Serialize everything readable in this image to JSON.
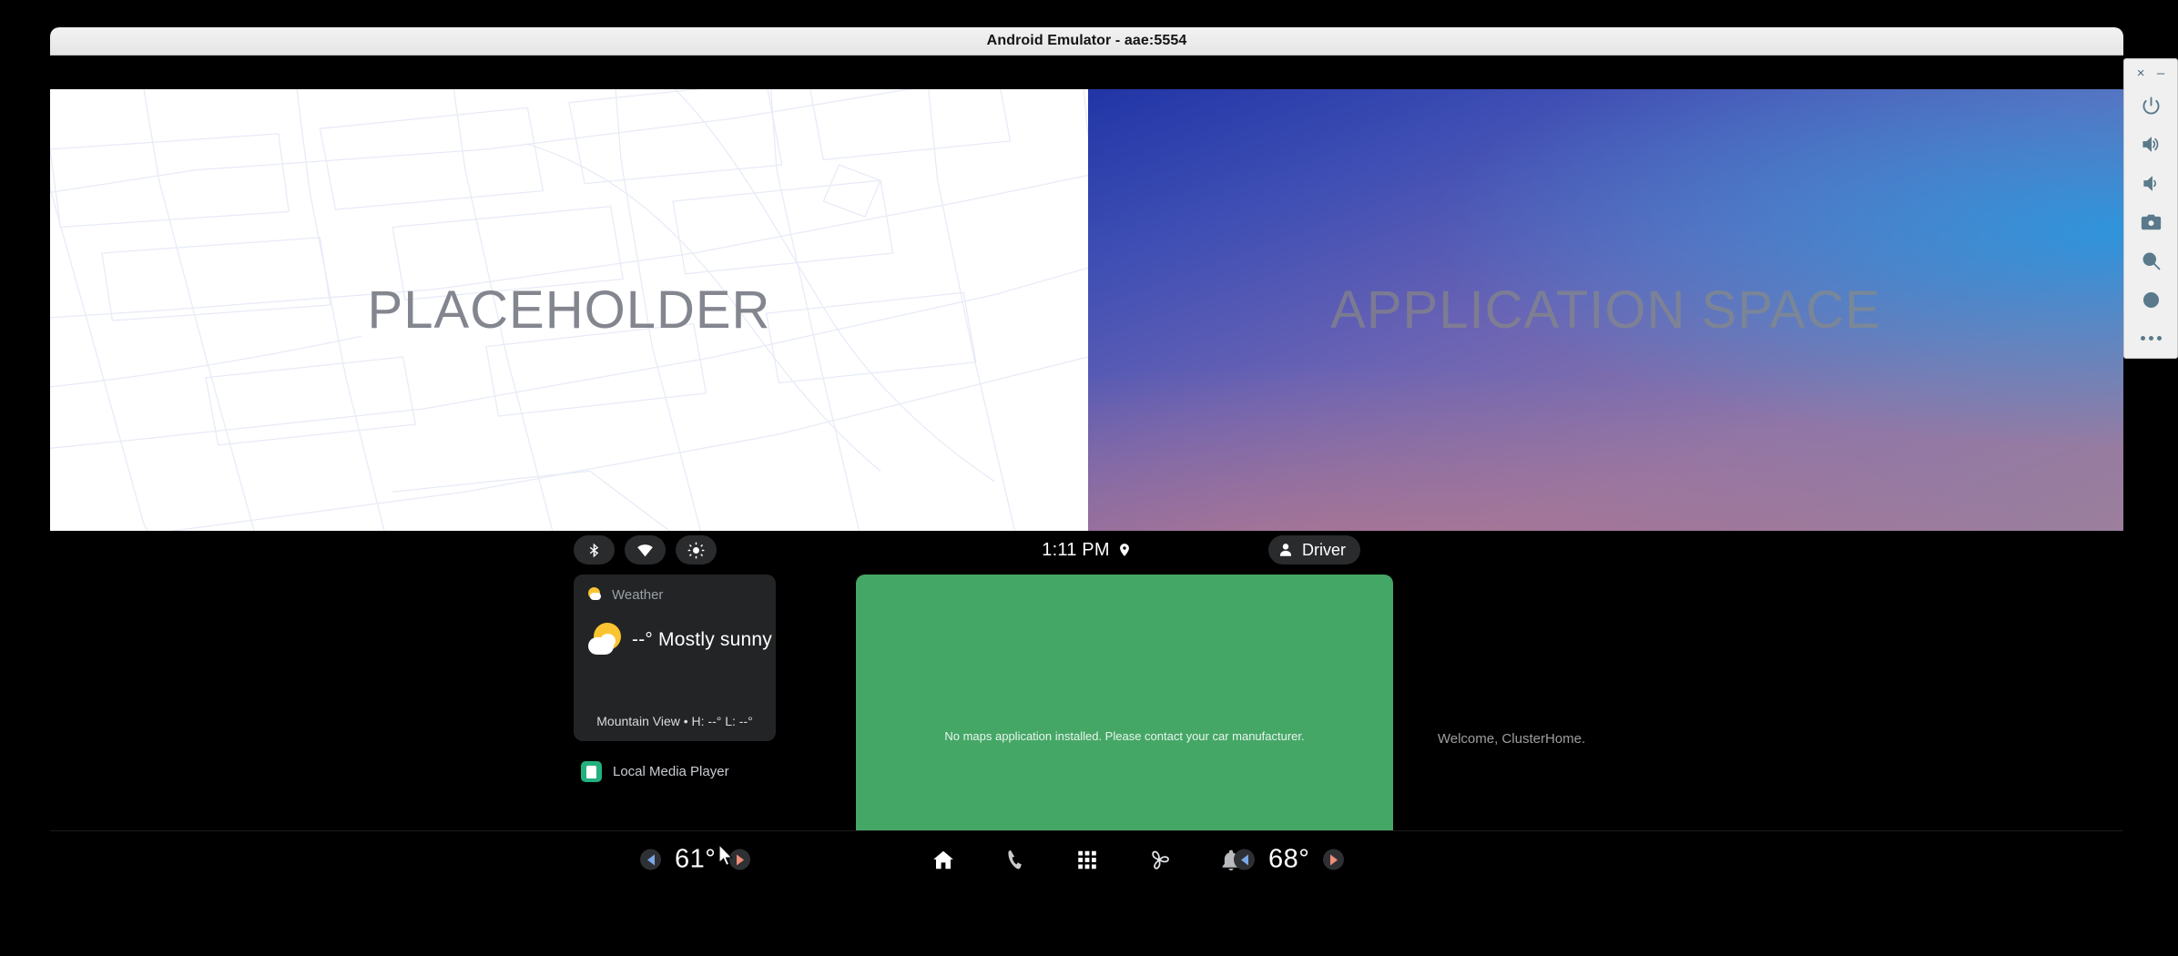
{
  "window": {
    "title": "Android Emulator - aae:5554"
  },
  "display": {
    "left_panel": {
      "label": "PLACEHOLDER"
    },
    "right_panel": {
      "label": "APPLICATION SPACE"
    }
  },
  "status_bar": {
    "icons": [
      {
        "name": "bluetooth-icon",
        "label": "Bluetooth"
      },
      {
        "name": "wifi-icon",
        "label": "Wi-Fi"
      },
      {
        "name": "brightness-icon",
        "label": "Brightness"
      }
    ],
    "clock": "1:11 PM",
    "location_icon": "location-pin-icon",
    "profile": {
      "label": "Driver",
      "icon": "person-icon"
    }
  },
  "weather_widget": {
    "header": "Weather",
    "temperature_condition": "--° Mostly sunny",
    "footer": "Mountain View • H: --° L: --°",
    "icon": "partly-sunny-icon"
  },
  "media": {
    "label": "Local Media Player",
    "icon": "media-player-icon"
  },
  "maps_card": {
    "message": "No maps application installed. Please contact your car manufacturer.",
    "color": "#45a766"
  },
  "cluster": {
    "message": "Welcome, ClusterHome."
  },
  "nav_bar": {
    "temp_left": {
      "value": "61°",
      "decrease": "◀",
      "increase": "▶"
    },
    "temp_right": {
      "value": "68°",
      "decrease": "◀",
      "increase": "▶"
    },
    "items": [
      {
        "name": "home",
        "icon": "home-icon"
      },
      {
        "name": "dialer",
        "icon": "phone-icon"
      },
      {
        "name": "app-grid",
        "icon": "apps-grid-icon"
      },
      {
        "name": "climate",
        "icon": "fan-icon"
      },
      {
        "name": "notifications",
        "icon": "bell-icon"
      }
    ]
  },
  "emulator_toolbar": {
    "close": "×",
    "minimize": "–",
    "buttons": [
      {
        "name": "power-button",
        "icon": "power-icon"
      },
      {
        "name": "volume-up-button",
        "icon": "volume-up-icon"
      },
      {
        "name": "volume-down-button",
        "icon": "volume-down-icon"
      },
      {
        "name": "screenshot-button",
        "icon": "camera-icon"
      },
      {
        "name": "zoom-button",
        "icon": "magnifier-icon"
      },
      {
        "name": "rotate-button",
        "icon": "circle-icon"
      },
      {
        "name": "more-button",
        "icon": "ellipsis-icon"
      }
    ]
  },
  "colors": {
    "accent_green": "#45a766",
    "panel_dark": "#222426",
    "cool_arrow": "#7ba7e8",
    "warm_arrow": "#ef8d79"
  }
}
